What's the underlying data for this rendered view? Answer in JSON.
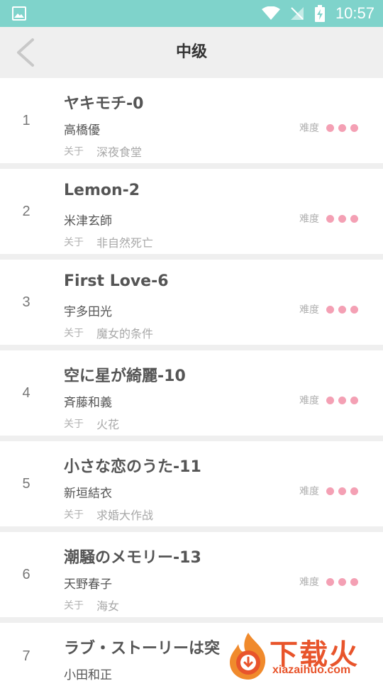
{
  "status_bar": {
    "time": "10:57"
  },
  "header": {
    "title": "中级"
  },
  "labels": {
    "about": "关于",
    "difficulty": "难度"
  },
  "songs": [
    {
      "index": "1",
      "title": "ヤキモチ-0",
      "artist": "高橋優",
      "about": "深夜食堂"
    },
    {
      "index": "2",
      "title": "Lemon-2",
      "artist": "米津玄師",
      "about": "非自然死亡"
    },
    {
      "index": "3",
      "title": "First Love-6",
      "artist": "宇多田光",
      "about": "魔女的条件"
    },
    {
      "index": "4",
      "title": "空に星が綺麗-10",
      "artist": "斉藤和義",
      "about": "火花"
    },
    {
      "index": "5",
      "title": "小さな恋のうた-11",
      "artist": "新垣結衣",
      "about": "求婚大作战"
    },
    {
      "index": "6",
      "title": "潮騒のメモリー-13",
      "artist": "天野春子",
      "about": "海女"
    },
    {
      "index": "7",
      "title": "ラブ・ストーリーは突",
      "artist": "小田和正",
      "about": ""
    }
  ],
  "difficulty_dots": 3,
  "colors": {
    "status_bar": "#7fd3cb",
    "dot": "#f4a0b4",
    "watermark": "#e8542b"
  },
  "watermark": {
    "text": "下载火",
    "url": "xiazaihuo.com"
  }
}
